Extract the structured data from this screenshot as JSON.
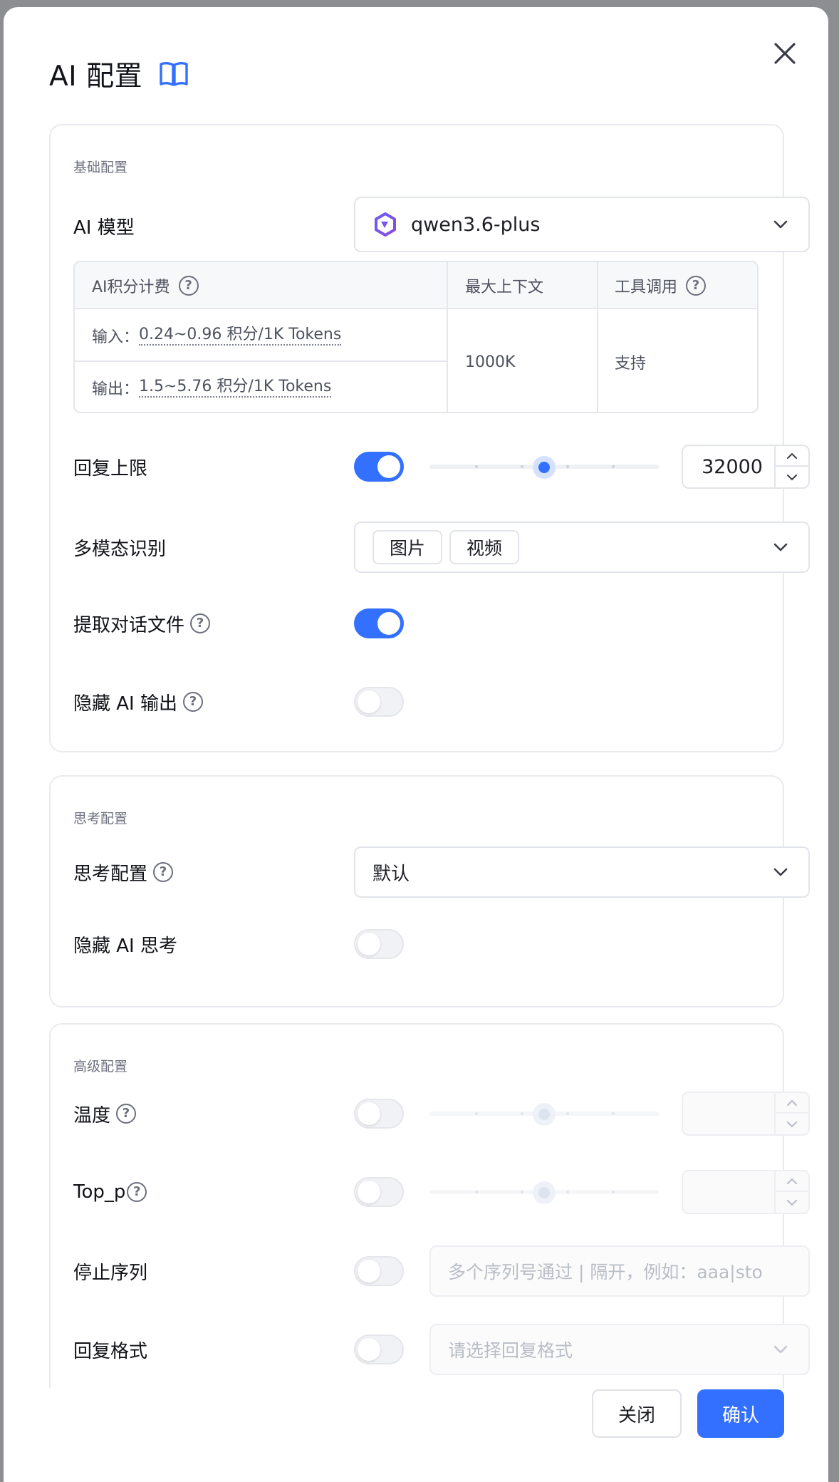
{
  "dialog": {
    "title": "AI 配置"
  },
  "basic": {
    "section_label": "基础配置",
    "model_label": "AI 模型",
    "model_value": "qwen3.6-plus",
    "pricing": {
      "col1_header": "AI积分计费",
      "col2_header": "最大上下文",
      "col3_header": "工具调用",
      "input_prefix": "输入：",
      "input_value": "0.24~0.96 积分/1K Tokens",
      "output_prefix": "输出：",
      "output_value": "1.5~5.76 积分/1K Tokens",
      "max_context": "1000K",
      "tool_call": "支持"
    },
    "reply_limit_label": "回复上限",
    "reply_limit_enabled": true,
    "reply_limit_value": "32000",
    "reply_limit_fraction": 0.5,
    "multimodal_label": "多模态识别",
    "multimodal_tags": [
      "图片",
      "视频"
    ],
    "extract_files_label": "提取对话文件",
    "extract_files_enabled": true,
    "hide_output_label": "隐藏 AI 输出",
    "hide_output_enabled": false
  },
  "thinking": {
    "section_label": "思考配置",
    "config_label": "思考配置",
    "config_value": "默认",
    "hide_thinking_label": "隐藏 AI 思考",
    "hide_thinking_enabled": false
  },
  "advanced": {
    "section_label": "高级配置",
    "temperature_label": "温度",
    "temperature_fraction": 0.5,
    "top_p_label": "Top_p",
    "top_p_fraction": 0.5,
    "stop_label": "停止序列",
    "stop_placeholder": "多个序列号通过 | 隔开，例如：aaa|sto",
    "format_label": "回复格式",
    "format_placeholder": "请选择回复格式"
  },
  "footer": {
    "close_label": "关闭",
    "confirm_label": "确认"
  },
  "colors": {
    "accent": "#3370ff"
  }
}
